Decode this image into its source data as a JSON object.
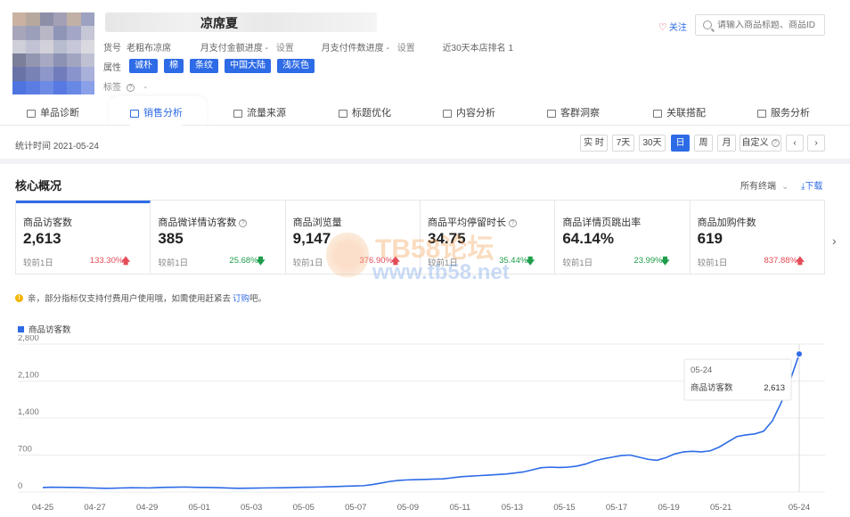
{
  "product": {
    "title_visible": "凉席夏",
    "meta": {
      "item_prefix": "货号",
      "item_value": "老粗布凉席",
      "monthly_amount_label": "月支付金额进度 -",
      "monthly_amount_link": "设置",
      "monthly_count_label": "月支付件数进度 -",
      "monthly_count_link": "设置",
      "rank_text": "近30天本店排名 1"
    },
    "attr_label": "属性",
    "attributes": [
      "诚朴",
      "棉",
      "条纹",
      "中国大陆",
      "浅灰色"
    ],
    "tag_label": "标签",
    "tag_value": "-"
  },
  "header": {
    "follow_label": "关注",
    "search_placeholder": "请输入商品标题、商品ID"
  },
  "tabs": [
    {
      "label": "单品诊断",
      "active": false
    },
    {
      "label": "销售分析",
      "active": true
    },
    {
      "label": "流量来源",
      "active": false
    },
    {
      "label": "标题优化",
      "active": false
    },
    {
      "label": "内容分析",
      "active": false
    },
    {
      "label": "客群洞察",
      "active": false
    },
    {
      "label": "关联搭配",
      "active": false
    },
    {
      "label": "服务分析",
      "active": false
    }
  ],
  "toolbar": {
    "stat_time": "统计时间 2021-05-24",
    "periods": [
      {
        "label": "实 时",
        "active": false
      },
      {
        "label": "7天",
        "active": false
      },
      {
        "label": "30天",
        "active": false
      },
      {
        "label": "日",
        "active": true
      },
      {
        "label": "周",
        "active": false
      },
      {
        "label": "月",
        "active": false
      },
      {
        "label": "自定义",
        "active": false
      }
    ],
    "prev": "‹",
    "next": "›"
  },
  "overview": {
    "title": "核心概况",
    "all_terms": "所有终端",
    "download": "下载",
    "compare_label": "较前1日",
    "cards": [
      {
        "name": "商品访客数",
        "value": "2,613",
        "pct": "133.30%",
        "dir": "up",
        "help": false
      },
      {
        "name": "商品微详情访客数",
        "value": "385",
        "pct": "25.68%",
        "dir": "down",
        "help": true
      },
      {
        "name": "商品浏览量",
        "value": "9,147",
        "pct": "376.90%",
        "dir": "up",
        "help": false
      },
      {
        "name": "商品平均停留时长",
        "value": "34.75",
        "pct": "35.44%",
        "dir": "down",
        "help": true
      },
      {
        "name": "商品详情页跳出率",
        "value": "64.14%",
        "pct": "23.99%",
        "dir": "down",
        "help": false
      },
      {
        "name": "商品加购件数",
        "value": "619",
        "pct": "837.88%",
        "dir": "up",
        "help": false
      }
    ],
    "notice_text": "亲，部分指标仅支持付费用户使用哦，如需使用赶紧去",
    "notice_link": "订购",
    "notice_tail": "吧。"
  },
  "watermark": {
    "line1": "TB58论坛",
    "line2": "www.tb58.net"
  },
  "chart_data": {
    "type": "line",
    "series": [
      {
        "name": "商品访客数",
        "values": [
          85,
          92,
          90,
          88,
          85,
          80,
          75,
          70,
          72,
          78,
          82,
          80,
          78,
          85,
          90,
          92,
          95,
          90,
          88,
          85,
          82,
          75,
          70,
          72,
          75,
          78,
          80,
          82,
          85,
          90,
          92,
          95,
          100,
          105,
          110,
          115,
          120,
          140,
          170,
          200,
          220,
          230,
          235,
          240,
          245,
          250,
          270,
          290,
          300,
          310,
          320,
          330,
          340,
          360,
          380,
          420,
          460,
          470,
          465,
          470,
          490,
          530,
          590,
          630,
          660,
          690,
          700,
          660,
          620,
          600,
          650,
          720,
          760,
          770,
          760,
          780,
          850,
          950,
          1050,
          1080,
          1100,
          1150,
          1350,
          1700,
          2120,
          2613
        ]
      }
    ],
    "x_ticks": [
      "04-25",
      "04-27",
      "04-29",
      "05-01",
      "05-03",
      "05-05",
      "05-07",
      "05-09",
      "05-11",
      "05-13",
      "05-15",
      "05-17",
      "05-19",
      "05-21",
      "05-24"
    ],
    "y_ticks": [
      "0",
      "700",
      "1,400",
      "2,100",
      "2,800"
    ],
    "ylim": [
      0,
      2800
    ],
    "tooltip": {
      "date": "05-24",
      "label": "商品访客数",
      "value": "2,613"
    },
    "color": "#2e6be6"
  }
}
